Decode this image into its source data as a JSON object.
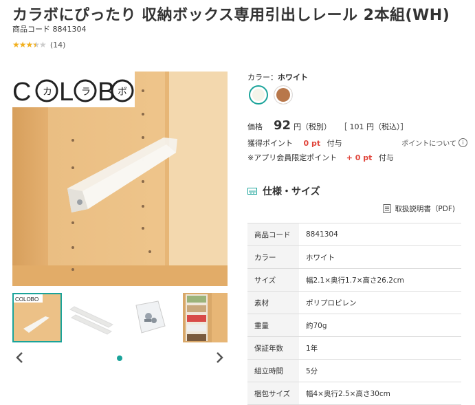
{
  "product": {
    "title": "カラボにぴったり 収納ボックス専用引出しレール 2本組(WH)",
    "code_label": "商品コード",
    "code": "8841304",
    "rating": 3.5,
    "review_count": "(14)"
  },
  "gallery": {
    "logo_text": "COLOBO",
    "logo_kana": [
      "カ",
      "ラ",
      "ボ"
    ],
    "thumb_logo_text": "COLOBO",
    "thumbnails": [
      "rail-mounted",
      "two-rails",
      "parts-bag",
      "shelf-with-boxes"
    ],
    "prev_icon": "chevron-left-icon",
    "next_icon": "chevron-right-icon"
  },
  "color": {
    "label": "カラー：",
    "selected": "ホワイト",
    "swatches": [
      {
        "name": "ホワイト",
        "hex": "#f4f4ea"
      },
      {
        "name": "ブラウン",
        "hex": "#b8774a"
      }
    ]
  },
  "price": {
    "label": "価格",
    "value": "92",
    "unit": "円（税別）",
    "tax_incl": "［ 101 円（税込）］"
  },
  "points": {
    "label": "獲得ポイント",
    "value": "0 pt",
    "suffix": "付与",
    "about_link": "ポイントについて",
    "app_label": "※アプリ会員限定ポイント",
    "app_value": "+ 0 pt",
    "app_suffix": "付与"
  },
  "spec": {
    "heading": "仕様・サイズ",
    "manual_link": "取扱説明書（PDF)",
    "rows": [
      {
        "key": "商品コード",
        "value": "8841304"
      },
      {
        "key": "カラー",
        "value": "ホワイト"
      },
      {
        "key": "サイズ",
        "value": "幅2.1×奥行1.7×高さ26.2cm"
      },
      {
        "key": "素材",
        "value": "ポリプロピレン"
      },
      {
        "key": "重量",
        "value": "約70g"
      },
      {
        "key": "保証年数",
        "value": "1年"
      },
      {
        "key": "組立時間",
        "value": "5分"
      },
      {
        "key": "梱包サイズ",
        "value": "幅4×奥行2.5×高さ30cm"
      }
    ]
  },
  "colors": {
    "accent": "#1aa39a",
    "point_red": "#e0443a",
    "star": "#f2b01e"
  }
}
